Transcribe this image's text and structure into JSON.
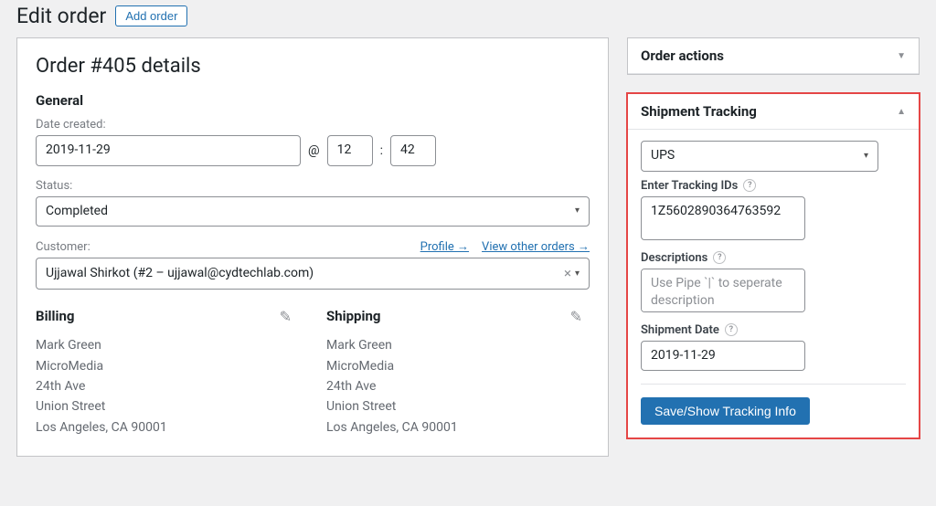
{
  "header": {
    "title": "Edit order",
    "add_label": "Add order"
  },
  "order": {
    "heading": "Order #405 details",
    "general_heading": "General",
    "date_label": "Date created:",
    "date_value": "2019-11-29",
    "at_symbol": "@",
    "hour": "12",
    "colon": ":",
    "minute": "42",
    "status_label": "Status:",
    "status_value": "Completed",
    "customer_label": "Customer:",
    "profile_link": "Profile →",
    "other_orders_link": "View other orders →",
    "customer_value": "Ujjawal Shirkot (#2 – ujjawal@cydtechlab.com)",
    "billing_title": "Billing",
    "shipping_title": "Shipping",
    "billing": {
      "line1": "Mark Green",
      "line2": "MicroMedia",
      "line3": "24th Ave",
      "line4": "Union Street",
      "line5": "Los Angeles, CA 90001"
    },
    "shipping": {
      "line1": "Mark Green",
      "line2": "MicroMedia",
      "line3": "24th Ave",
      "line4": "Union Street",
      "line5": "Los Angeles, CA 90001"
    }
  },
  "sidebar": {
    "order_actions": {
      "title": "Order actions"
    },
    "tracking": {
      "title": "Shipment Tracking",
      "carrier": "UPS",
      "ids_label": "Enter Tracking IDs",
      "ids_value": "1Z5602890364763592",
      "desc_label": "Descriptions",
      "desc_placeholder": "Use Pipe `|` to seperate description",
      "date_label": "Shipment Date",
      "date_value": "2019-11-29",
      "save_label": "Save/Show Tracking Info"
    }
  }
}
